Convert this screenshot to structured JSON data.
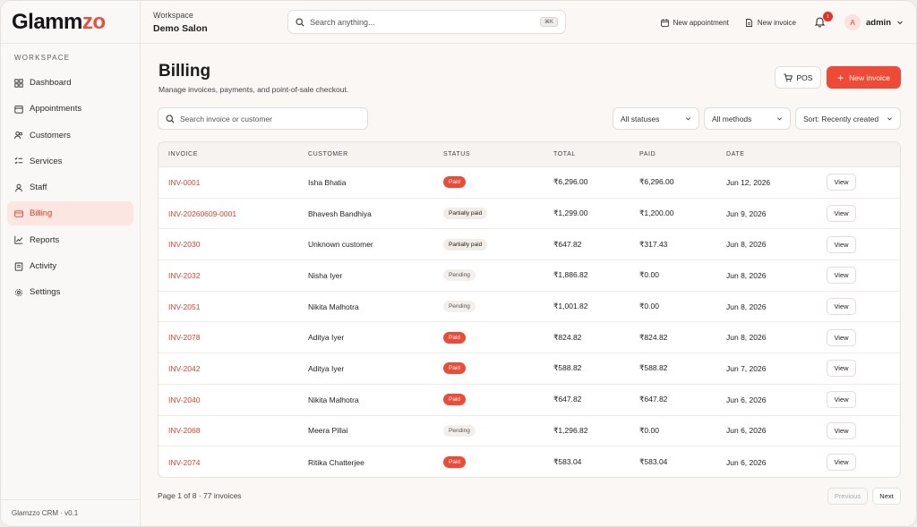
{
  "brand": {
    "name_part1": "Glamm",
    "name_part2": "zo",
    "accent_color": "#ee4d3a"
  },
  "sidebar": {
    "section_label": "WORKSPACE",
    "items": [
      {
        "label": "Dashboard",
        "icon": "grid-icon",
        "active": false
      },
      {
        "label": "Appointments",
        "icon": "calendar-icon",
        "active": false
      },
      {
        "label": "Customers",
        "icon": "users-icon",
        "active": false
      },
      {
        "label": "Services",
        "icon": "list-check-icon",
        "active": false
      },
      {
        "label": "Staff",
        "icon": "user-icon",
        "active": false
      },
      {
        "label": "Billing",
        "icon": "card-icon",
        "active": true
      },
      {
        "label": "Reports",
        "icon": "chart-icon",
        "active": false
      },
      {
        "label": "Activity",
        "icon": "activity-icon",
        "active": false
      },
      {
        "label": "Settings",
        "icon": "gear-icon",
        "active": false
      }
    ],
    "footer": "Glamzzo CRM · v0.1"
  },
  "topbar": {
    "workspace_label": "Workspace",
    "workspace_name": "Demo Salon",
    "search_placeholder": "Search anything...",
    "search_shortcut": "⌘K",
    "new_appointment": "New appointment",
    "new_invoice": "New invoice",
    "notification_count": "1",
    "user_initial": "A",
    "user_name": "admin"
  },
  "page": {
    "title": "Billing",
    "subtitle": "Manage invoices, payments, and point-of-sale checkout.",
    "pos_label": "POS",
    "new_invoice_label": "New invoice",
    "search_placeholder": "Search invoice or customer",
    "filter_status": "All statuses",
    "filter_method": "All methods",
    "sort": "Sort: Recently created"
  },
  "table": {
    "columns": [
      "INVOICE",
      "CUSTOMER",
      "STATUS",
      "TOTAL",
      "PAID",
      "DATE"
    ],
    "view_label": "View",
    "rows": [
      {
        "invoice": "INV-0001",
        "customer": "Isha Bhatia",
        "status": "Paid",
        "status_type": "paid",
        "total": "₹6,296.00",
        "paid": "₹6,296.00",
        "date": "Jun 12, 2026"
      },
      {
        "invoice": "INV-20260609-0001",
        "customer": "Bhavesh Bandhiya",
        "status": "Partially paid",
        "status_type": "partial",
        "total": "₹1,299.00",
        "paid": "₹1,200.00",
        "date": "Jun 9, 2026"
      },
      {
        "invoice": "INV-2030",
        "customer": "Unknown customer",
        "status": "Partially paid",
        "status_type": "partial",
        "total": "₹647.82",
        "paid": "₹317.43",
        "date": "Jun 8, 2026"
      },
      {
        "invoice": "INV-2032",
        "customer": "Nisha Iyer",
        "status": "Pending",
        "status_type": "pending",
        "total": "₹1,886.82",
        "paid": "₹0.00",
        "date": "Jun 8, 2026"
      },
      {
        "invoice": "INV-2051",
        "customer": "Nikita Malhotra",
        "status": "Pending",
        "status_type": "pending",
        "total": "₹1,001.82",
        "paid": "₹0.00",
        "date": "Jun 8, 2026"
      },
      {
        "invoice": "INV-2078",
        "customer": "Aditya Iyer",
        "status": "Paid",
        "status_type": "paid",
        "total": "₹824.82",
        "paid": "₹824.82",
        "date": "Jun 8, 2026"
      },
      {
        "invoice": "INV-2042",
        "customer": "Aditya Iyer",
        "status": "Paid",
        "status_type": "paid",
        "total": "₹588.82",
        "paid": "₹588.82",
        "date": "Jun 7, 2026"
      },
      {
        "invoice": "INV-2040",
        "customer": "Nikita Malhotra",
        "status": "Paid",
        "status_type": "paid",
        "total": "₹647.82",
        "paid": "₹647.82",
        "date": "Jun 6, 2026"
      },
      {
        "invoice": "INV-2068",
        "customer": "Meera Pillai",
        "status": "Pending",
        "status_type": "pending",
        "total": "₹1,296.82",
        "paid": "₹0.00",
        "date": "Jun 6, 2026"
      },
      {
        "invoice": "INV-2074",
        "customer": "Ritika Chatterjee",
        "status": "Paid",
        "status_type": "paid",
        "total": "₹583.04",
        "paid": "₹583.04",
        "date": "Jun 6, 2026"
      }
    ]
  },
  "pagination": {
    "info": "Page 1 of 8 · 77 invoices",
    "previous": "Previous",
    "next": "Next"
  }
}
